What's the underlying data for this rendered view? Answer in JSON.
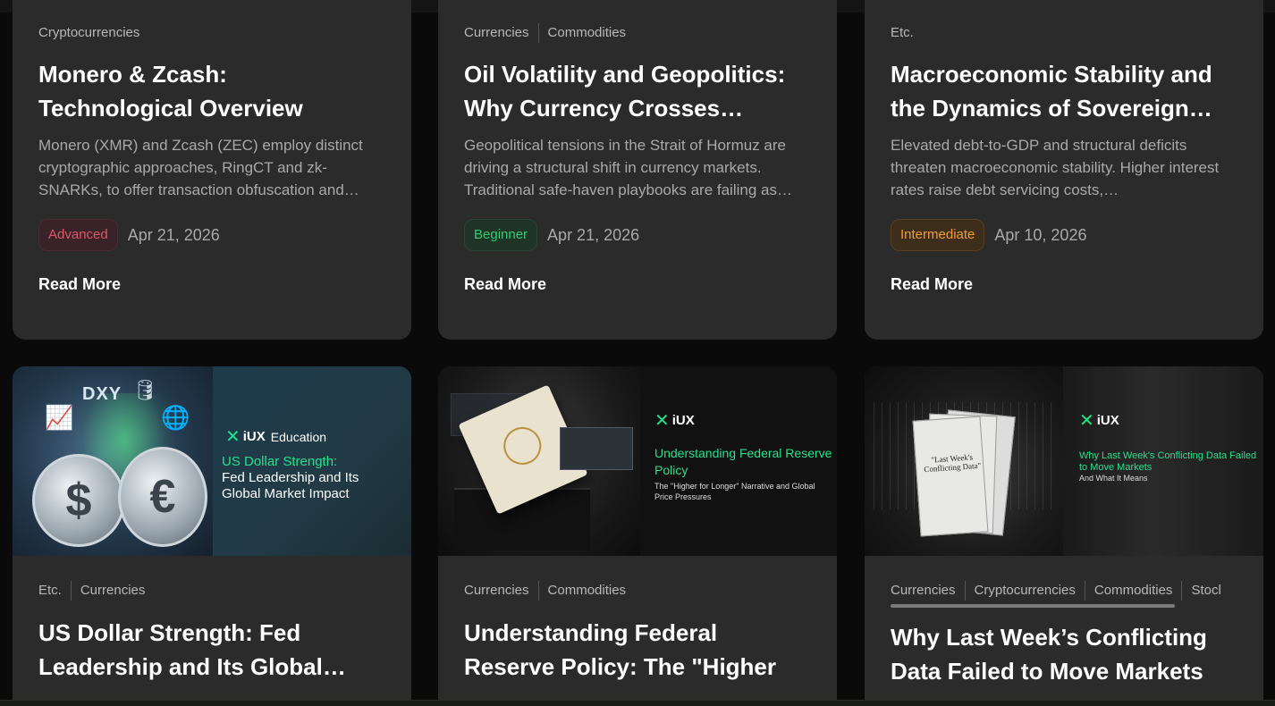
{
  "cards_top": [
    {
      "categories": [
        "Cryptocurrencies"
      ],
      "title": "Monero & Zcash: Technological Overview",
      "description": "Monero (XMR) and Zcash (ZEC) employ distinct cryptographic approaches, RingCT and zk-SNARKs, to offer transaction obfuscation and…",
      "level": "Advanced",
      "date": "Apr 21, 2026",
      "read_more": "Read More"
    },
    {
      "categories": [
        "Currencies",
        "Commodities"
      ],
      "title": "Oil Volatility and Geopolitics: Why Currency Crosses…",
      "description": "Geopolitical tensions in the Strait of Hormuz are driving a structural shift in currency markets. Traditional safe-haven playbooks are failing as…",
      "level": "Beginner",
      "date": "Apr 21, 2026",
      "read_more": "Read More"
    },
    {
      "categories": [
        "Etc."
      ],
      "title": "Macroeconomic Stability and the Dynamics of Sovereign…",
      "description": "Elevated debt-to-GDP and structural deficits threaten macroeconomic stability. Higher interest rates raise debt servicing costs,…",
      "level": "Intermediate",
      "date": "Apr 10, 2026",
      "read_more": "Read More"
    }
  ],
  "cards_bottom": [
    {
      "thumb": {
        "dxy": "DXY",
        "brand": "iUX",
        "brand_sub": "Education",
        "headline": "US Dollar Strength:",
        "subheadline": "Fed Leadership and Its Global Market Impact"
      },
      "categories": [
        "Etc.",
        "Currencies"
      ],
      "title": "US Dollar Strength: Fed Leadership and Its Global…"
    },
    {
      "thumb": {
        "brand": "iUX",
        "headline": "Understanding Federal Reserve Policy",
        "subheadline": "The \"Higher for Longer\" Narrative and Global Price Pressures"
      },
      "categories": [
        "Currencies",
        "Commodities"
      ],
      "title": "Understanding Federal Reserve Policy: The \"Higher for Longer…"
    },
    {
      "thumb": {
        "brand": "iUX",
        "paper_text": "\"Last Week's Conflicting Data\"",
        "headline": "Why Last Week's Conflicting Data Failed to Move Markets",
        "subheadline": "And What It Means"
      },
      "categories": [
        "Currencies",
        "Cryptocurrencies",
        "Commodities",
        "Stocl"
      ],
      "title": "Why Last Week’s Conflicting Data Failed to Move Markets —…"
    }
  ],
  "colors": {
    "card_bg": "#2b2b2b",
    "advanced": "#e0566a",
    "beginner": "#2ecf73",
    "intermediate": "#f39b2c",
    "brand_green": "#25e08e"
  }
}
